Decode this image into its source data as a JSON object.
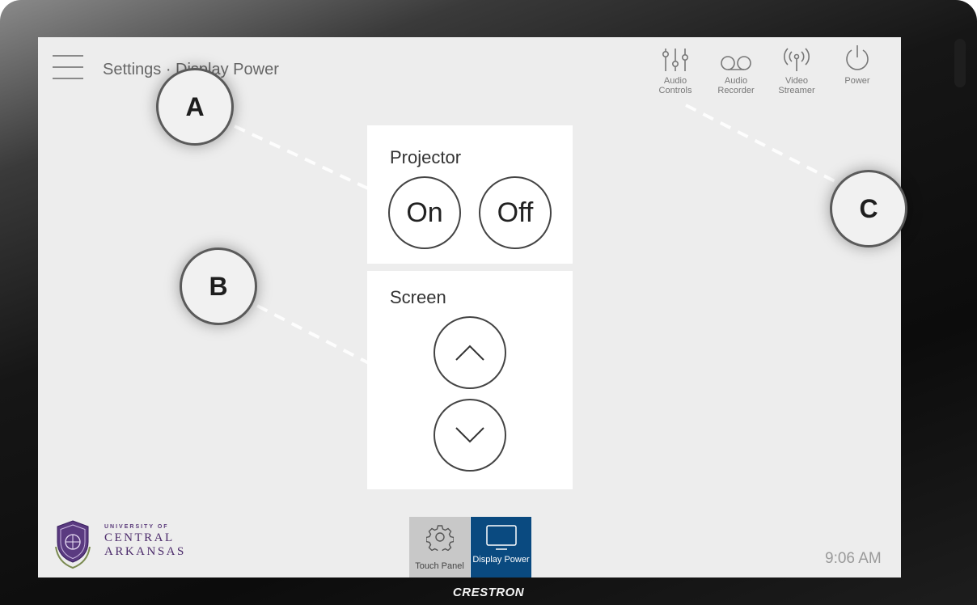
{
  "header": {
    "title": "Settings · Display Power",
    "icons": [
      {
        "icon": "audio-controls-icon",
        "label": "Audio Controls"
      },
      {
        "icon": "audio-recorder-icon",
        "label": "Audio Recorder"
      },
      {
        "icon": "video-streamer-icon",
        "label": "Video Streamer"
      },
      {
        "icon": "power-icon",
        "label": "Power"
      }
    ]
  },
  "projector": {
    "title": "Projector",
    "on_label": "On",
    "off_label": "Off"
  },
  "screen_panel": {
    "title": "Screen"
  },
  "bottom_nav": {
    "tabs": [
      {
        "label": "Touch Panel",
        "icon": "gear-icon",
        "active": false
      },
      {
        "label": "Display Power",
        "icon": "monitor-icon",
        "active": true
      }
    ]
  },
  "logo": {
    "line1": "UNIVERSITY OF",
    "line2": "CENTRAL",
    "line3": "ARKANSAS"
  },
  "clock": "9:06 AM",
  "device_brand": "CRESTRON",
  "callouts": {
    "a": "A",
    "b": "B",
    "c": "C"
  },
  "colors": {
    "active_tab": "#0a4a80",
    "inactive_tab": "#c8c8c8",
    "screen_bg": "#ededed",
    "logo_purple": "#4b2a6a"
  }
}
